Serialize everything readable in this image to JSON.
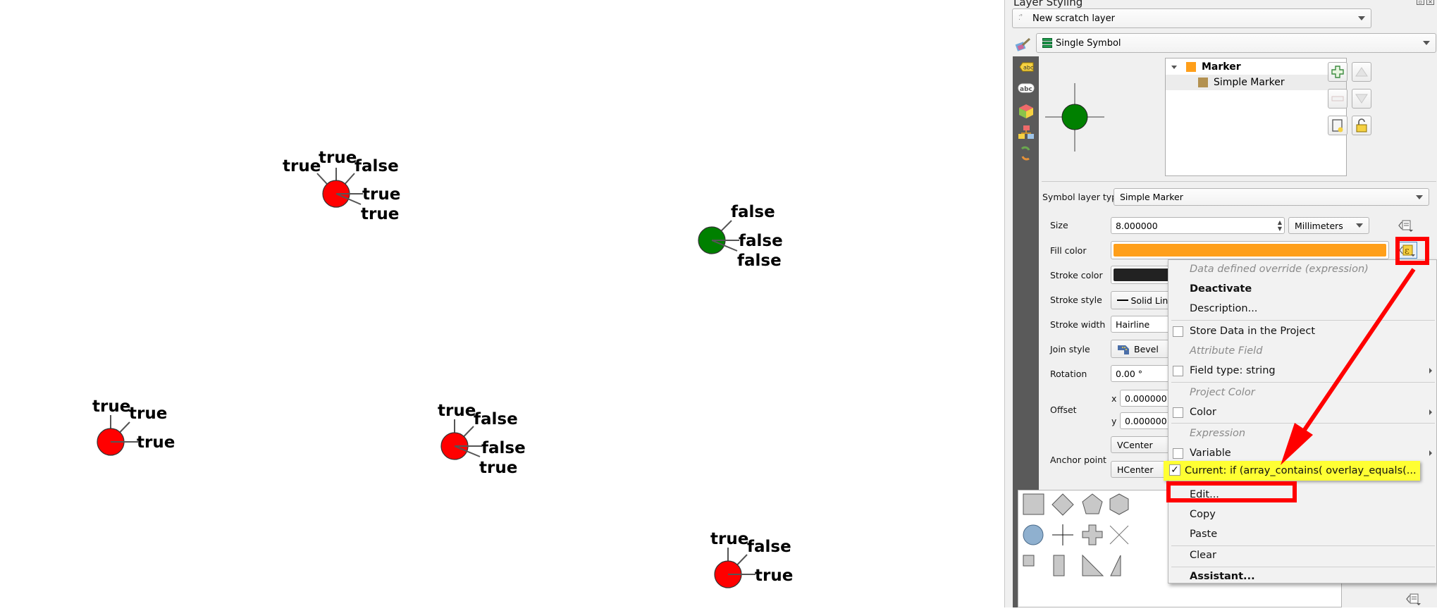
{
  "map": {
    "points": [
      {
        "fill": "#ff0000",
        "labels": [
          "true",
          "true",
          "false",
          "true",
          "true"
        ]
      },
      {
        "fill": "#008000",
        "labels": [
          "false",
          "false",
          "false"
        ]
      },
      {
        "fill": "#ff0000",
        "labels": [
          "true",
          "true",
          "true"
        ]
      },
      {
        "fill": "#ff0000",
        "labels": [
          "true",
          "false",
          "false",
          "true"
        ]
      },
      {
        "fill": "#ff0000",
        "labels": [
          "true",
          "false",
          "true"
        ]
      }
    ]
  },
  "panel": {
    "title": "Layer Styling",
    "layer_combo": "New scratch layer",
    "renderer_combo": "Single Symbol",
    "side_tabs": [
      "labels-icon",
      "masks-icon",
      "3d-view-icon",
      "diagrams-icon",
      "history-icon"
    ],
    "symbol_tree": {
      "root": {
        "label": "Marker",
        "color": "#ff9f1a"
      },
      "child": {
        "label": "Simple Marker",
        "color": "#b39150"
      }
    },
    "preview_fill": "#008000",
    "symbol_layer_type_label": "Symbol layer type",
    "symbol_layer_type_value": "Simple Marker",
    "size_label": "Size",
    "size_value": "8.000000",
    "size_unit": "Millimeters",
    "fill_color_label": "Fill color",
    "fill_color": "#ff9f1a",
    "stroke_color_label": "Stroke color",
    "stroke_color": "#222222",
    "stroke_style_label": "Stroke style",
    "stroke_style_value": "Solid Line",
    "stroke_width_label": "Stroke width",
    "stroke_width_value": "Hairline",
    "join_style_label": "Join style",
    "join_style_value": "Bevel",
    "rotation_label": "Rotation",
    "rotation_value": "0.00 °",
    "offset_label": "Offset",
    "offset_x_label": "x",
    "offset_x": "0.000000",
    "offset_y_label": "y",
    "offset_y": "0.000000",
    "anchor_label": "Anchor point",
    "anchor_v": "VCenter",
    "anchor_h": "HCenter"
  },
  "context_menu": {
    "items": [
      {
        "type": "section",
        "label": "Data defined override (expression)"
      },
      {
        "type": "bold",
        "label": "Deactivate"
      },
      {
        "type": "item",
        "label": "Description..."
      },
      {
        "type": "check",
        "label": "Store Data in the Project",
        "checked": false
      },
      {
        "type": "section",
        "label": "Attribute Field"
      },
      {
        "type": "check",
        "label": "Field type: string",
        "checked": false,
        "submenu": true
      },
      {
        "type": "section",
        "label": "Project Color"
      },
      {
        "type": "check",
        "label": "Color",
        "checked": false,
        "submenu": true
      },
      {
        "type": "section",
        "label": "Expression"
      },
      {
        "type": "check",
        "label": "Variable",
        "checked": false,
        "submenu": true
      },
      {
        "type": "item",
        "label": "Edit..."
      },
      {
        "type": "item",
        "label": "Copy"
      },
      {
        "type": "item",
        "label": "Paste"
      },
      {
        "type": "item",
        "label": "Clear"
      },
      {
        "type": "bold",
        "label": "Assistant..."
      }
    ],
    "current": {
      "label": "Current: if (array_contains( overlay_equals(...",
      "checked": true,
      "highlight": "#ffff33"
    }
  },
  "annotations": {
    "color": "#ff0000"
  }
}
